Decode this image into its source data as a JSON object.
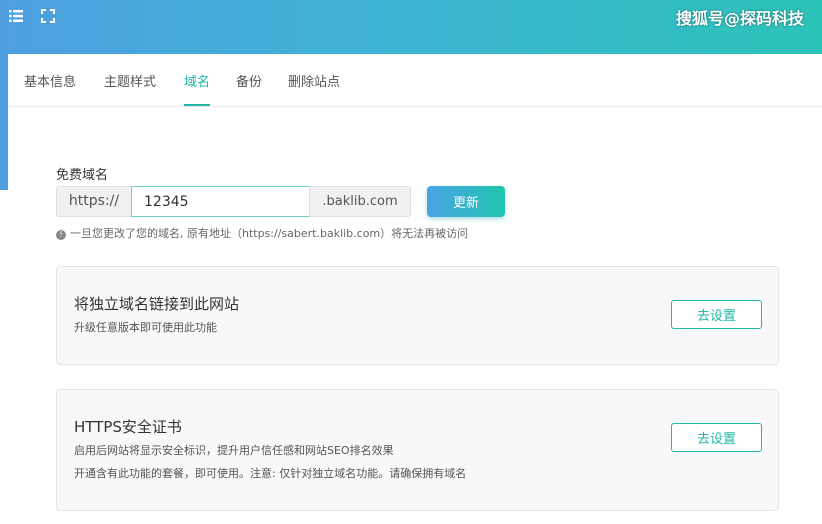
{
  "header": {
    "watermark": "搜狐号@探码科技",
    "menu_icon": "list-icon",
    "expand_icon": "fullscreen-icon",
    "accent": "#20b6a8"
  },
  "tabs": [
    {
      "label": "基本信息",
      "active": false
    },
    {
      "label": "主题样式",
      "active": false
    },
    {
      "label": "域名",
      "active": true
    },
    {
      "label": "备份",
      "active": false
    },
    {
      "label": "删除站点",
      "active": false
    }
  ],
  "free_domain": {
    "label": "免费域名",
    "prefix": "https://",
    "value": "12345",
    "suffix": ".baklib.com",
    "update_label": "更新",
    "note": "一旦您更改了您的域名, 原有地址（https://sabert.baklib.com）将无法再被访问"
  },
  "custom_domain": {
    "title": "将独立域名链接到此网站",
    "desc": "升级任意版本即可使用此功能",
    "button": "去设置"
  },
  "https": {
    "title": "HTTPS安全证书",
    "desc1": "启用后网站将显示安全标识，提升用户信任感和网站SEO排名效果",
    "desc2": "开通含有此功能的套餐，即可使用。注意: 仅针对独立域名功能。请确保拥有域名",
    "button": "去设置"
  }
}
